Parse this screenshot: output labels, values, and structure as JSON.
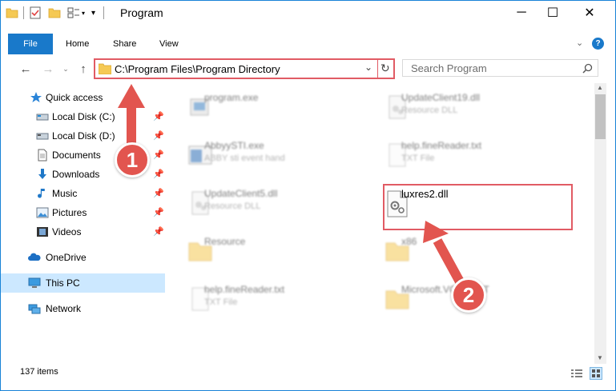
{
  "window": {
    "title": "Program",
    "controls": {
      "minimize": "─",
      "maximize": "☐",
      "close": "✕"
    }
  },
  "ribbon": {
    "tabs": [
      "File",
      "Home",
      "Share",
      "View"
    ]
  },
  "address": {
    "path": "C:\\Program Files\\Program Directory",
    "search_placeholder": "Search Program"
  },
  "nav": {
    "items": [
      {
        "label": "Quick access",
        "icon": "star-icon"
      },
      {
        "label": "Local Disk (C:)",
        "icon": "drive-icon",
        "pinned": true
      },
      {
        "label": "Local Disk (D:)",
        "icon": "drive-icon",
        "pinned": true
      },
      {
        "label": "Documents",
        "icon": "documents-icon",
        "pinned": true
      },
      {
        "label": "Downloads",
        "icon": "downloads-icon",
        "pinned": true
      },
      {
        "label": "Music",
        "icon": "music-icon",
        "pinned": true
      },
      {
        "label": "Pictures",
        "icon": "pictures-icon",
        "pinned": true
      },
      {
        "label": "Videos",
        "icon": "videos-icon",
        "pinned": true
      },
      {
        "label": "OneDrive",
        "icon": "cloud-icon"
      },
      {
        "label": "This PC",
        "icon": "computer-icon",
        "selected": true
      },
      {
        "label": "Network",
        "icon": "network-icon"
      }
    ]
  },
  "files": [
    {
      "name": "program.exe",
      "type": "",
      "icon": "exe-icon"
    },
    {
      "name": "UpdateClient19.dll",
      "type": "Resource DLL",
      "icon": "dll-icon"
    },
    {
      "name": "AbbyySTI.exe",
      "type": "ABBY sti event hand",
      "icon": "app-window-icon"
    },
    {
      "name": "help.fineReader.txt",
      "type": "TXT File",
      "icon": "txt-icon"
    },
    {
      "name": "UpdateClient5.dll",
      "type": "Resource DLL",
      "icon": "dll-icon"
    },
    {
      "name": "luxres2.dll",
      "type": "",
      "icon": "dll-icon"
    },
    {
      "name": "Resource",
      "type": "",
      "icon": "folder-icon"
    },
    {
      "name": "x86",
      "type": "",
      "icon": "folder-icon"
    },
    {
      "name": "help.fineReader.txt",
      "type": "TXT File",
      "icon": "txt-icon"
    },
    {
      "name": "Microsoft.VC90.CRT",
      "type": "",
      "icon": "folder-icon"
    }
  ],
  "status": {
    "count": "137 items"
  },
  "annotations": {
    "step1": "1",
    "step2": "2"
  },
  "colors": {
    "accent": "#1979ca",
    "highlight": "#e15b64",
    "badge": "#e2554f",
    "selected": "#cce8ff"
  }
}
